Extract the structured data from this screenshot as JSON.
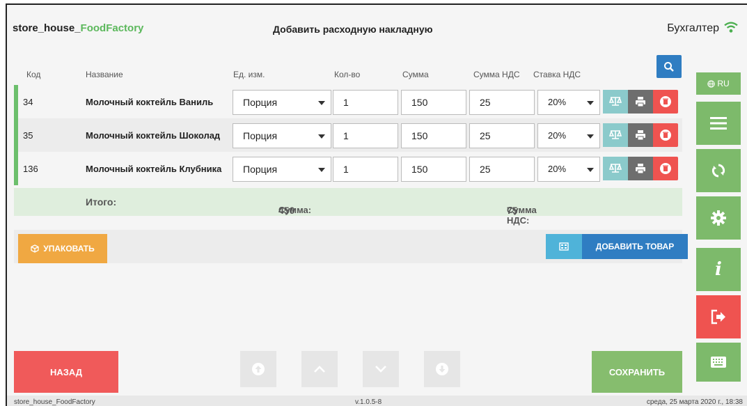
{
  "header": {
    "brand_prefix": "store_house_",
    "brand_accent": "FoodFactory",
    "page_title": "Добавить расходную накладную",
    "user": "Бухгалтер"
  },
  "table": {
    "columns": {
      "code": "Код",
      "name": "Название",
      "unit": "Ед. изм.",
      "qty": "Кол-во",
      "sum": "Сумма",
      "vat_sum": "Сумма НДС",
      "vat_rate": "Ставка НДС"
    },
    "rows": [
      {
        "code": "34",
        "name": "Молочный коктейль Ваниль",
        "unit": "Порция",
        "qty": "1",
        "sum": "150",
        "vat_sum": "25",
        "vat_rate": "20%"
      },
      {
        "code": "35",
        "name": "Молочный коктейль Шоколад",
        "unit": "Порция",
        "qty": "1",
        "sum": "150",
        "vat_sum": "25",
        "vat_rate": "20%"
      },
      {
        "code": "136",
        "name": "Молочный коктейль Клубника",
        "unit": "Порция",
        "qty": "1",
        "sum": "150",
        "vat_sum": "25",
        "vat_rate": "20%"
      }
    ]
  },
  "totals": {
    "label": "Итого:",
    "sum_label": "Сумма:",
    "sum_value": "450",
    "vat_label": "Сумма НДС:",
    "vat_value": "75"
  },
  "toolbar": {
    "pack_label": "УПАКОВАТЬ",
    "add_label": "ДОБАВИТЬ ТОВАР"
  },
  "sidebar": {
    "lang": "RU"
  },
  "footer": {
    "back_label": "НАЗАД",
    "save_label": "СОХРАНИТЬ"
  },
  "statusbar": {
    "app": "store_house_FoodFactory",
    "version": "v.1.0.5-8",
    "datetime": "среда, 25 марта 2020 г., 18:38"
  },
  "colors": {
    "accent_green": "#5cb85c",
    "primary_blue": "#2f7dc2",
    "danger_red": "#ef5350",
    "warning_orange": "#f0a842"
  }
}
